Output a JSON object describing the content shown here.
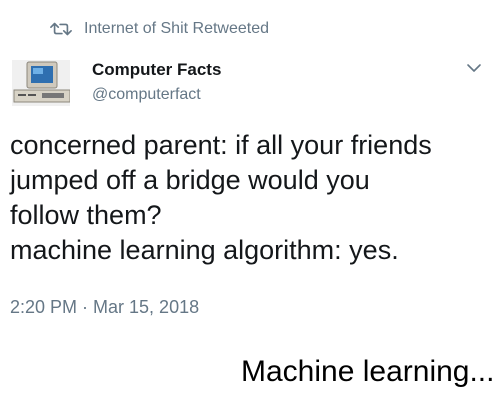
{
  "retweet": {
    "icon": "retweet-icon",
    "text": "Internet of Shit Retweeted"
  },
  "author": {
    "avatar": "computer-avatar",
    "name": "Computer Facts",
    "handle": "@computerfact"
  },
  "tweet": {
    "lines": [
      "concerned parent: if all your friends",
      "jumped off a bridge would you",
      "follow them?",
      "machine learning algorithm: yes."
    ],
    "timestamp": "2:20 PM · Mar 15, 2018"
  },
  "caption": "Machine learning...",
  "colors": {
    "text": "#14171a",
    "muted": "#657786",
    "background": "#ffffff"
  }
}
